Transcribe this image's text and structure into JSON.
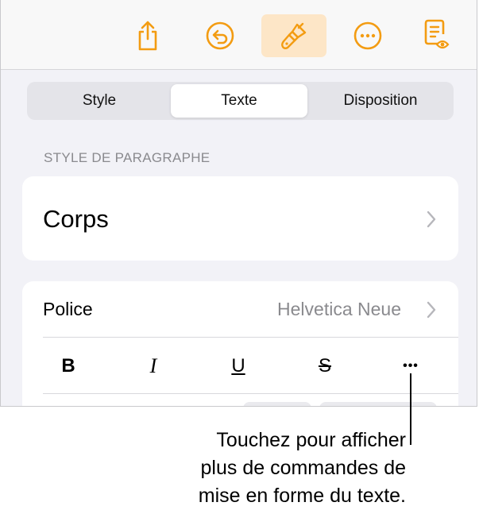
{
  "toolbar": {
    "icons": [
      "share-icon",
      "undo-icon",
      "format-paintbrush-icon",
      "more-icon",
      "reading-view-icon"
    ],
    "accent_color": "#f39c12",
    "active_bg": "#fde6c7"
  },
  "tabs": {
    "items": [
      "Style",
      "Texte",
      "Disposition"
    ],
    "selected": "Texte"
  },
  "paragraph_style": {
    "section_title": "STYLE DE PARAGRAPHE",
    "value": "Corps"
  },
  "font": {
    "label": "Police",
    "value": "Helvetica Neue"
  },
  "format_buttons": {
    "bold": "B",
    "italic": "I",
    "underline": "U",
    "strikethrough": "S",
    "more": "•••"
  },
  "callout": {
    "lines": [
      "Touchez pour afficher",
      "plus de commandes de",
      "mise en forme du texte."
    ]
  }
}
